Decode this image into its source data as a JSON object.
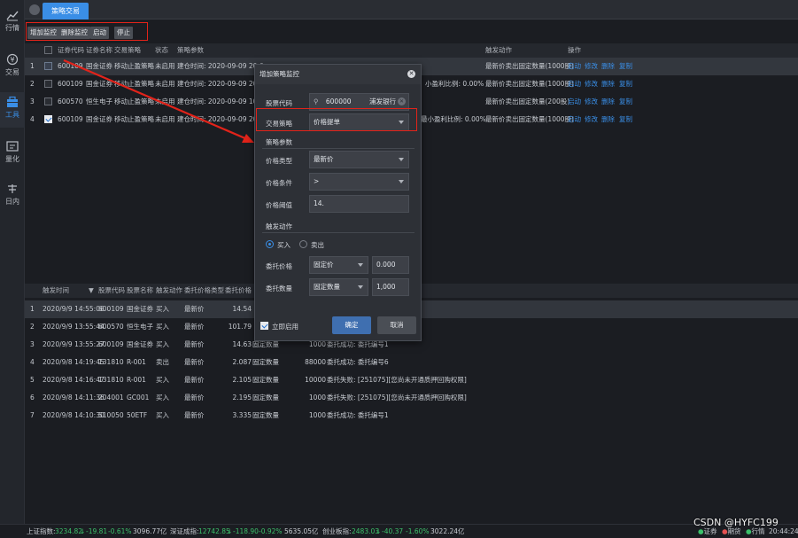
{
  "sidebar": {
    "items": [
      {
        "label": "行情",
        "icon": "chart-icon"
      },
      {
        "label": "交易",
        "icon": "trade-icon"
      },
      {
        "label": "工具",
        "icon": "toolbox-icon"
      },
      {
        "label": "量化",
        "icon": "quant-icon"
      },
      {
        "label": "日内",
        "icon": "intraday-icon"
      }
    ]
  },
  "tabs": [
    {
      "label": "策略交易"
    }
  ],
  "toolbar": {
    "add": "增加监控",
    "remove": "删除监控",
    "start": "启动",
    "stop": "停止"
  },
  "monitor_table": {
    "headers": [
      "证券代码",
      "证券名称",
      "交易策略",
      "状态",
      "策略参数",
      "触发动作",
      "操作"
    ],
    "rows": [
      {
        "num": "1",
        "code": "600109",
        "name": "国金证券",
        "strategy": "移动止盈策略",
        "status": "未启用",
        "params": "建仓时间: 2020-09-09 20:0",
        "params_tail": "",
        "action": "最新价卖出固定数量(1000股)",
        "checked": false
      },
      {
        "num": "2",
        "code": "600109",
        "name": "国金证券",
        "strategy": "移动止盈策略",
        "status": "未启用",
        "params": "建仓时间: 2020-09-09 20:1",
        "params_tail": "小盈利比例: 0.00%",
        "action": "最新价卖出固定数量(1000股)",
        "checked": false
      },
      {
        "num": "3",
        "code": "600570",
        "name": "恒生电子",
        "strategy": "移动止盈策略",
        "status": "未启用",
        "params": "建仓时间: 2020-09-09 10:3",
        "params_tail": "",
        "action": "最新价卖出固定数量(200股)",
        "checked": false
      },
      {
        "num": "4",
        "code": "600109",
        "name": "国金证券",
        "strategy": "移动止盈策略",
        "status": "未启用",
        "params": "建仓时间: 2020-09-09 20:1",
        "params_tail": "最小盈利比例: 0.00%",
        "action": "最新价卖出固定数量(1000股)",
        "checked": true
      }
    ],
    "ops": [
      "启动",
      "修改",
      "删除",
      "复制"
    ]
  },
  "trigger_table": {
    "headers": [
      "触发时间",
      "股票代码",
      "股票名称",
      "触发动作",
      "委托价格类型",
      "委托价格"
    ],
    "rows": [
      {
        "num": "1",
        "time": "2020/9/9 14:55:06",
        "code": "600109",
        "name": "国金证券",
        "action": "买入",
        "ptype": "最新价",
        "price": "14.54",
        "qtype": "",
        "qty": "",
        "result": ""
      },
      {
        "num": "2",
        "time": "2020/9/9 13:55:44",
        "code": "600570",
        "name": "恒生电子",
        "action": "买入",
        "ptype": "最新价",
        "price": "101.79",
        "qtype": "",
        "qty": "",
        "result": ""
      },
      {
        "num": "3",
        "time": "2020/9/9 13:55:27",
        "code": "600109",
        "name": "国金证券",
        "action": "买入",
        "ptype": "最新价",
        "price": "14.63",
        "qtype": "固定数量",
        "qty": "1000",
        "result": "委托成功: 委托编号1"
      },
      {
        "num": "4",
        "time": "2020/9/8 14:19:45",
        "code": "131810",
        "name": "R-001",
        "action": "卖出",
        "ptype": "最新价",
        "price": "2.087",
        "qtype": "固定数量",
        "qty": "88000",
        "result": "委托成功: 委托编号6"
      },
      {
        "num": "5",
        "time": "2020/9/8 14:16:47",
        "code": "131810",
        "name": "R-001",
        "action": "买入",
        "ptype": "最新价",
        "price": "2.105",
        "qtype": "固定数量",
        "qty": "10000",
        "result": "委托失败: [251075][您尚未开通质押回购权限]"
      },
      {
        "num": "6",
        "time": "2020/9/8 14:11:36",
        "code": "204001",
        "name": "GC001",
        "action": "买入",
        "ptype": "最新价",
        "price": "2.195",
        "qtype": "固定数量",
        "qty": "1000",
        "result": "委托失败: [251075][您尚未开通质押回购权限]"
      },
      {
        "num": "7",
        "time": "2020/9/8 14:10:30",
        "code": "510050",
        "name": "50ETF",
        "action": "买入",
        "ptype": "最新价",
        "price": "3.335",
        "qtype": "固定数量",
        "qty": "1000",
        "result": "委托成功: 委托编号1"
      }
    ]
  },
  "dialog": {
    "title": "增加策略监控",
    "stock_code_label": "股票代码",
    "stock_code_value": "600000",
    "stock_name": "浦发银行",
    "strategy_label": "交易策略",
    "strategy_value": "价格提单",
    "params_section": "策略参数",
    "price_type_label": "价格类型",
    "price_type_value": "最新价",
    "price_cond_label": "价格条件",
    "price_cond_value": ">",
    "price_threshold_label": "价格阈值",
    "price_threshold_value": "14.",
    "trigger_section": "触发动作",
    "buy_label": "买入",
    "sell_label": "卖出",
    "order_price_label": "委托价格",
    "order_price_type": "固定价",
    "order_price_value": "0.000",
    "order_qty_label": "委托数量",
    "order_qty_type": "固定数量",
    "order_qty_value": "1,000",
    "enable_now_label": "立即启用",
    "ok": "确定",
    "cancel": "取消"
  },
  "status_bar": {
    "sh_label": "上证指数:",
    "sh_value": "3234.82",
    "sh_chg": "-19.81",
    "sh_pct": "-0.61%",
    "sh_amt": "3096.77亿",
    "sz_label": "深证成指:",
    "sz_value": "12742.85",
    "sz_chg": "-118.90",
    "sz_pct": "-0.92%",
    "sz_amt": "5635.05亿",
    "cy_label": "创业板指:",
    "cy_value": "2483.03",
    "cy_chg": "-40.37",
    "cy_pct": "-1.60%",
    "cy_amt": "3022.24亿",
    "legend": [
      "证券",
      "期货",
      "行情"
    ],
    "time": "20:44:24"
  },
  "watermark": "CSDN @HYFC199",
  "colors": {
    "accent": "#3a8ee6",
    "highlight": "#e2231a",
    "up": "#e55252",
    "down": "#3cc06a"
  }
}
